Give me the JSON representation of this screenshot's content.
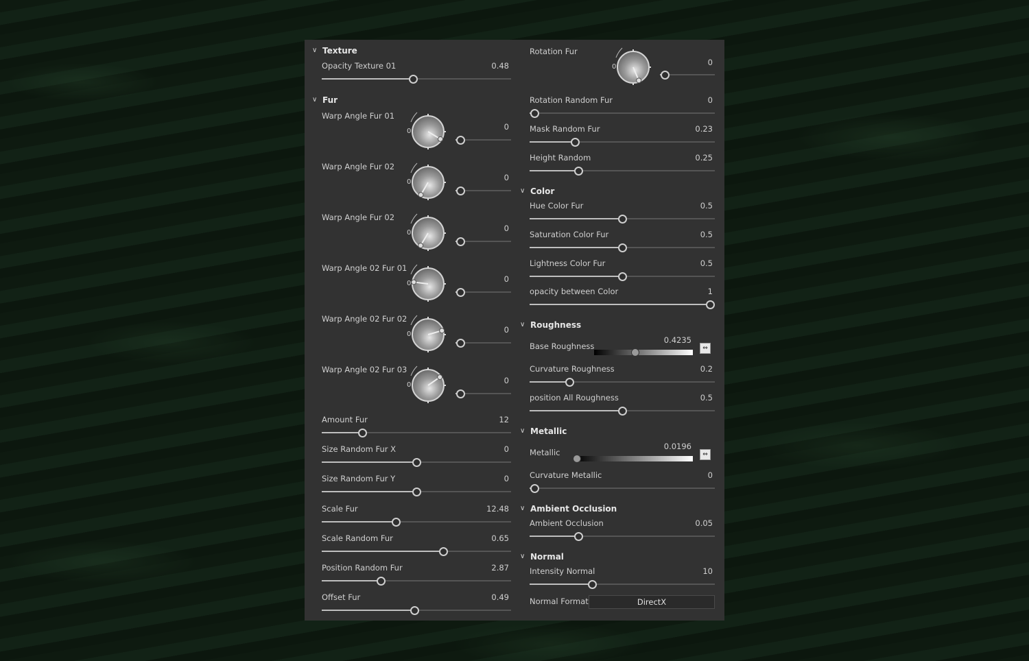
{
  "left": [
    {
      "type": "header",
      "label": "Texture"
    },
    {
      "type": "slider",
      "label": "Opacity Texture 01",
      "value": "0.48",
      "fraction": 0.48
    },
    {
      "type": "header",
      "label": "Fur"
    },
    {
      "type": "knob",
      "label": "Warp Angle Fur 01",
      "value": "0",
      "fraction": 0,
      "angle_deg": 31,
      "knob_zero": "0"
    },
    {
      "type": "knob",
      "label": "Warp Angle Fur 02",
      "value": "0",
      "fraction": 0,
      "angle_deg": 120,
      "knob_zero": "0"
    },
    {
      "type": "knob",
      "label": "Warp Angle Fur 02",
      "value": "0",
      "fraction": 0,
      "angle_deg": 121,
      "knob_zero": "0"
    },
    {
      "type": "knob",
      "label": "Warp Angle 02 Fur 01",
      "value": "0",
      "fraction": 0,
      "angle_deg": 187,
      "knob_zero": "0"
    },
    {
      "type": "knob",
      "label": "Warp Angle 02 Fur 02",
      "value": "0",
      "fraction": 0,
      "angle_deg": -16,
      "knob_zero": "0"
    },
    {
      "type": "knob",
      "label": "Warp Angle 02 Fur 03",
      "value": "0",
      "fraction": 0,
      "angle_deg": -35,
      "knob_zero": "0"
    },
    {
      "type": "slider",
      "label": "Amount Fur",
      "value": "12",
      "fraction": 0.2
    },
    {
      "type": "slider",
      "label": "Size Random Fur X",
      "value": "0",
      "fraction": 0.5
    },
    {
      "type": "slider",
      "label": "Size Random Fur Y",
      "value": "0",
      "fraction": 0.5
    },
    {
      "type": "slider",
      "label": "Scale Fur",
      "value": "12.48",
      "fraction": 0.385
    },
    {
      "type": "slider",
      "label": "Scale Random Fur",
      "value": "0.65",
      "fraction": 0.65
    },
    {
      "type": "slider",
      "label": "Position Random Fur",
      "value": "2.87",
      "fraction": 0.3
    },
    {
      "type": "slider",
      "label": "Offset Fur",
      "value": "0.49",
      "fraction": 0.49
    }
  ],
  "right": [
    {
      "type": "knob",
      "label": "Rotation Fur",
      "value": "0",
      "fraction": 0,
      "angle_deg": 67,
      "knob_zero": "0"
    },
    {
      "type": "slider",
      "label": "Rotation Random Fur",
      "value": "0",
      "fraction": 0
    },
    {
      "type": "slider",
      "label": "Mask Random Fur",
      "value": "0.23",
      "fraction": 0.23
    },
    {
      "type": "slider",
      "label": "Height Random",
      "value": "0.25",
      "fraction": 0.25
    },
    {
      "type": "header",
      "label": "Color"
    },
    {
      "type": "slider",
      "label": "Hue Color Fur",
      "value": "0.5",
      "fraction": 0.5
    },
    {
      "type": "slider",
      "label": "Saturation Color Fur",
      "value": "0.5",
      "fraction": 0.5
    },
    {
      "type": "slider",
      "label": "Lightness Color Fur",
      "value": "0.5",
      "fraction": 0.5
    },
    {
      "type": "slider",
      "label": "opacity between Color",
      "value": "1",
      "fraction": 1
    },
    {
      "type": "header",
      "label": "Roughness"
    },
    {
      "type": "gradient",
      "label": "Base Roughness",
      "value": "0.4235",
      "fraction": 0.4235
    },
    {
      "type": "slider",
      "label": "Curvature Roughness",
      "value": "0.2",
      "fraction": 0.2
    },
    {
      "type": "slider",
      "label": "position All Roughness",
      "value": "0.5",
      "fraction": 0.5
    },
    {
      "type": "header",
      "label": "Metallic"
    },
    {
      "type": "gradient",
      "label": "Metallic",
      "value": "0.0196",
      "fraction": 0.0196
    },
    {
      "type": "slider",
      "label": "Curvature Metallic",
      "value": "0",
      "fraction": 0
    },
    {
      "type": "header",
      "label": "Ambient Occlusion"
    },
    {
      "type": "slider",
      "label": "Ambient Occlusion",
      "value": "0.05",
      "fraction": 0.25
    },
    {
      "type": "header",
      "label": "Normal"
    },
    {
      "type": "slider",
      "label": "Intensity Normal",
      "value": "10",
      "fraction": 0.33
    },
    {
      "type": "select",
      "label": "Normal Format",
      "value": "DirectX"
    }
  ]
}
